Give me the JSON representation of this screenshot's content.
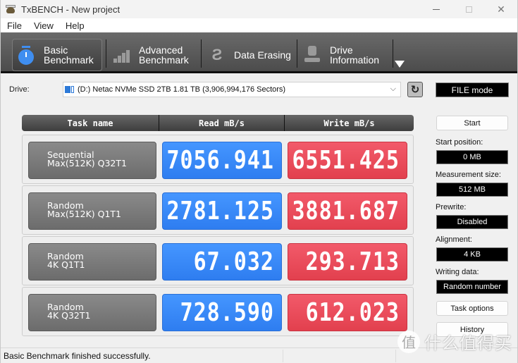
{
  "window": {
    "title": "TxBENCH - New project",
    "controls": {
      "minimize": "minimize",
      "maximize": "maximize",
      "close": "✕"
    }
  },
  "menu": [
    "File",
    "View",
    "Help"
  ],
  "toolbar": {
    "tabs": [
      {
        "label": "Basic\nBenchmark",
        "icon": "stopwatch-icon",
        "active": true
      },
      {
        "label": "Advanced\nBenchmark",
        "icon": "bar-chart-icon",
        "active": false
      },
      {
        "label": "Data Erasing",
        "icon": "eraser-icon",
        "active": false
      },
      {
        "label": "Drive\nInformation",
        "icon": "drive-info-icon",
        "active": false
      }
    ],
    "more_icon": "triangle-down-icon"
  },
  "drive": {
    "label": "Drive:",
    "selected": "(D:) Netac NVMe SSD 2TB  1.81 TB (3,906,994,176 Sectors)",
    "refresh_icon": "refresh-icon",
    "mode": "FILE mode"
  },
  "results": {
    "headers": [
      "Task name",
      "Read mB/s",
      "Write mB/s"
    ],
    "rows": [
      {
        "task_line1": "Sequential",
        "task_line2": "Max(512K) Q32T1",
        "read": "7056.941",
        "write": "6551.425"
      },
      {
        "task_line1": "Random",
        "task_line2": "Max(512K) Q1T1",
        "read": "2781.125",
        "write": "3881.687"
      },
      {
        "task_line1": "Random",
        "task_line2": "4K Q1T1",
        "read": "67.032",
        "write": "293.713"
      },
      {
        "task_line1": "Random",
        "task_line2": "4K Q32T1",
        "read": "728.590",
        "write": "612.023"
      }
    ]
  },
  "settings": {
    "start_button": "Start",
    "start_position": {
      "label": "Start position:",
      "value": "0 MB"
    },
    "measurement_size": {
      "label": "Measurement size:",
      "value": "512 MB"
    },
    "prewrite": {
      "label": "Prewrite:",
      "value": "Disabled"
    },
    "alignment": {
      "label": "Alignment:",
      "value": "4 KB"
    },
    "writing_data": {
      "label": "Writing data:",
      "value": "Random number"
    },
    "task_options_button": "Task options",
    "history_button": "History"
  },
  "status": {
    "message": "Basic Benchmark finished successfully."
  },
  "watermark": {
    "badge": "值",
    "text": "什么值得买"
  },
  "colors": {
    "read": "#3a8af8",
    "write": "#ea4c5b",
    "task": "#7c7c7c"
  }
}
